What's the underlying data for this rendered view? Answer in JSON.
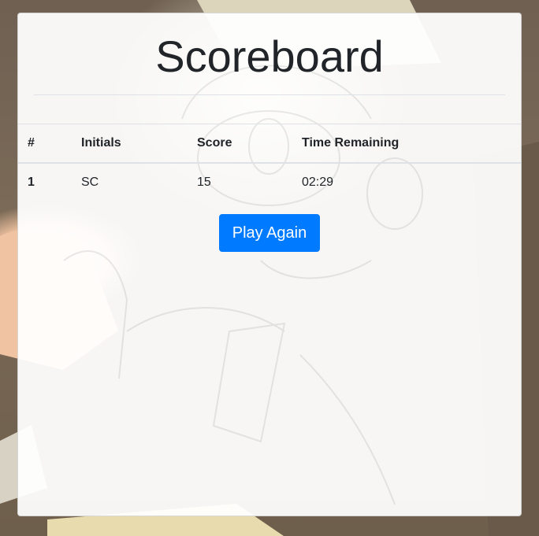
{
  "page": {
    "title": "Scoreboard"
  },
  "scoreboard": {
    "columns": [
      "#",
      "Initials",
      "Score",
      "Time Remaining"
    ],
    "rows": [
      {
        "rank": "1",
        "initials": "SC",
        "score": "15",
        "time_remaining": "02:29"
      }
    ]
  },
  "actions": {
    "play_again_label": "Play Again"
  },
  "colors": {
    "primary_button": "#007bff",
    "text": "#212529",
    "divider": "#dee2e6"
  }
}
